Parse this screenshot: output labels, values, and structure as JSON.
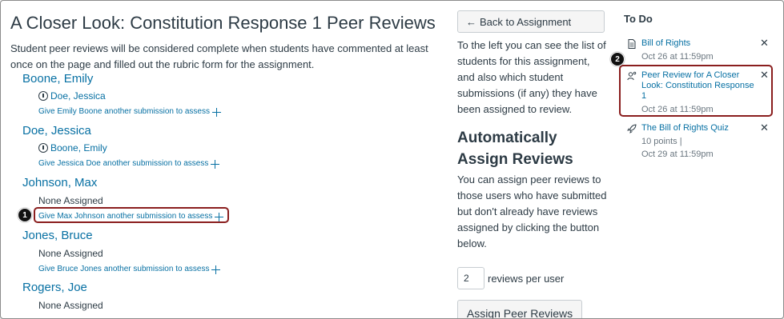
{
  "page": {
    "title": "A Closer Look: Constitution Response 1 Peer Reviews",
    "intro": "Student peer reviews will be considered complete when students have commented at least once on the page and filled out the rubric form for the assignment."
  },
  "students": [
    {
      "name": "Boone, Emily",
      "assessor": "Doe, Jessica",
      "none_label": "",
      "give_link": "Give Emily Boone another submission to assess"
    },
    {
      "name": "Doe, Jessica",
      "assessor": "Boone, Emily",
      "none_label": "",
      "give_link": "Give Jessica Doe another submission to assess"
    },
    {
      "name": "Johnson, Max",
      "assessor": "",
      "none_label": "None Assigned",
      "give_link": "Give Max Johnson another submission to assess"
    },
    {
      "name": "Jones, Bruce",
      "assessor": "",
      "none_label": "None Assigned",
      "give_link": "Give Bruce Jones another submission to assess"
    },
    {
      "name": "Rogers, Joe",
      "assessor": "",
      "none_label": "None Assigned",
      "give_link": ""
    }
  ],
  "sidebar": {
    "back_label": "Back to Assignment",
    "info_text": "To the left you can see the list of students for this assignment, and also which student submissions (if any) they have been assigned to review.",
    "auto_heading": "Automatically Assign Reviews",
    "auto_text": "You can assign peer reviews to those users who have submitted but don't already have reviews assigned by clicking the button below.",
    "reviews_value": "2",
    "reviews_label": "reviews per user",
    "assign_button": "Assign Peer Reviews"
  },
  "todo": {
    "heading": "To Do",
    "items": [
      {
        "title": "Bill of Rights",
        "meta1": "Oct 26 at 11:59pm",
        "meta2": "",
        "icon": "document-icon"
      },
      {
        "title": "Peer Review for A Closer Look: Constitution Response 1",
        "meta1": "Oct 26 at 11:59pm",
        "meta2": "",
        "icon": "peer-review-icon"
      },
      {
        "title": "The Bill of Rights Quiz",
        "meta1": "10 points  |",
        "meta2": "Oct 29 at 11:59pm",
        "icon": "rocket-icon"
      }
    ],
    "close_glyph": "✕"
  },
  "callouts": [
    "1",
    "2"
  ],
  "colors": {
    "link": "#0770a3",
    "text": "#2d3b45",
    "callout_border": "#8a1e1e"
  }
}
